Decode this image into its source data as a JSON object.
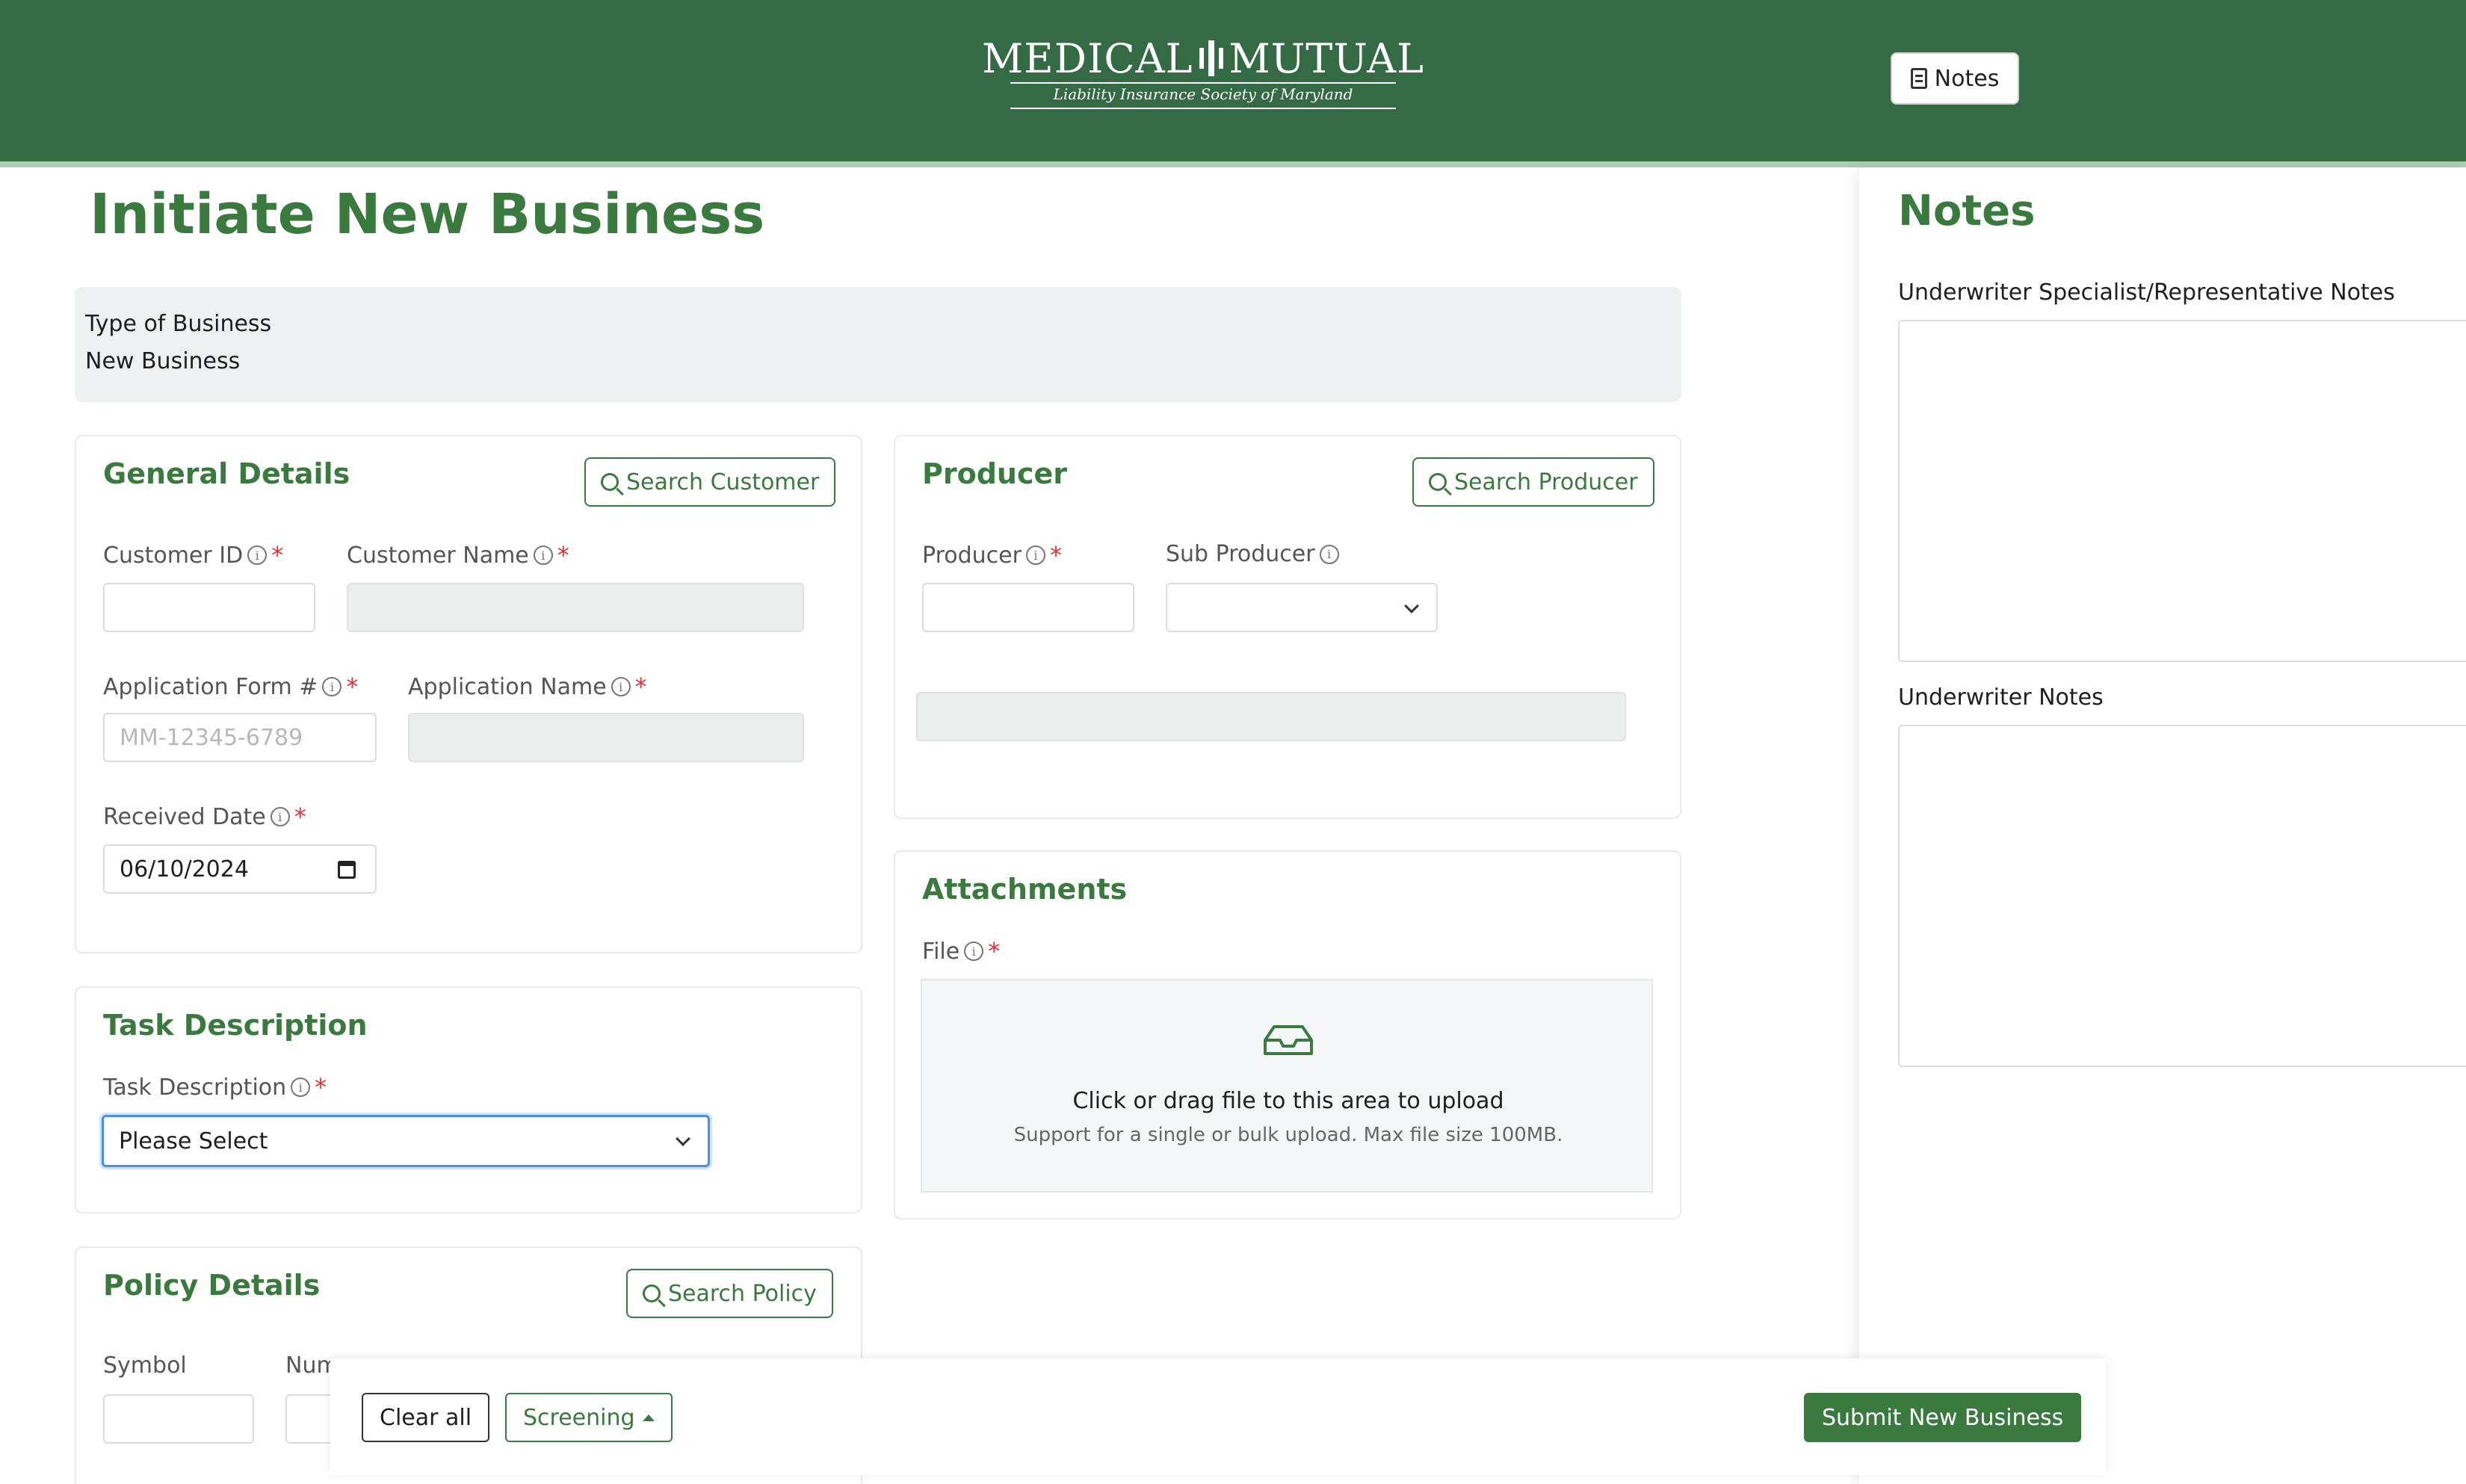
{
  "header": {
    "logo_word1": "MEDICAL",
    "logo_word2": "MUTUAL",
    "logo_subtitle": "Liability Insurance Society of Maryland",
    "notes_button": "Notes"
  },
  "page": {
    "title": "Initiate New Business"
  },
  "type_of_business": {
    "label": "Type of Business",
    "value": "New Business"
  },
  "general_details": {
    "title": "General Details",
    "search_button": "Search Customer",
    "customer_id_label": "Customer ID",
    "customer_id_value": "",
    "customer_name_label": "Customer Name",
    "customer_name_value": "",
    "application_form_label": "Application Form #",
    "application_form_placeholder": "MM-12345-6789",
    "application_name_label": "Application Name",
    "application_name_value": "",
    "received_date_label": "Received Date",
    "received_date_value": "06/10/2024"
  },
  "producer": {
    "title": "Producer",
    "search_button": "Search Producer",
    "producer_label": "Producer",
    "producer_value": "",
    "sub_producer_label": "Sub Producer",
    "sub_producer_value": ""
  },
  "attachments": {
    "title": "Attachments",
    "file_label": "File",
    "upload_text": "Click or drag file to this area to upload",
    "upload_hint": "Support for a single or bulk upload. Max file size 100MB."
  },
  "task_description": {
    "title": "Task Description",
    "label": "Task Description",
    "selected": "Please Select"
  },
  "policy_details": {
    "title": "Policy Details",
    "search_button": "Search Policy",
    "symbol_label": "Symbol",
    "number_label_partial": "Num"
  },
  "notes_panel": {
    "title": "Notes",
    "specialist_label": "Underwriter Specialist/Representative Notes",
    "underwriter_label": "Underwriter Notes"
  },
  "footer": {
    "clear_all": "Clear all",
    "screening": "Screening",
    "submit": "Submit New Business"
  },
  "colors": {
    "brand_green": "#346b44",
    "accent_green": "#3a7a3f",
    "required_red": "#dd3333"
  },
  "icons": [
    "notes-icon",
    "search-icon",
    "info-icon",
    "chevron-down-icon",
    "calendar-icon",
    "inbox-icon",
    "caret-up-icon"
  ]
}
